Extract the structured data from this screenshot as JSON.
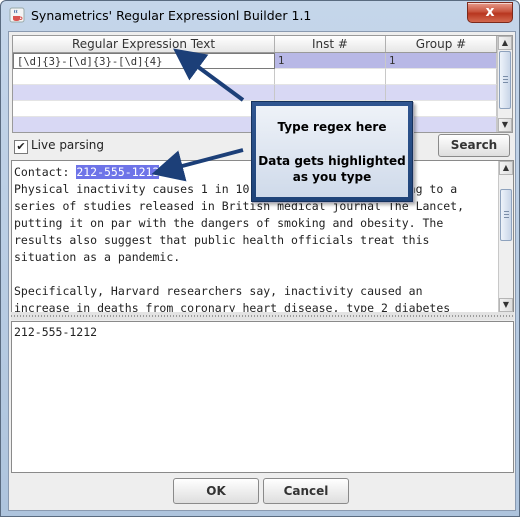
{
  "window": {
    "title": "Synametrics' Regular Expressionl Builder 1.1",
    "close_glyph": "x"
  },
  "table": {
    "columns": [
      "Regular Expression Text",
      "Inst #",
      "Group #"
    ],
    "rows": [
      [
        "[\\d]{3}-[\\d]{3}-[\\d]{4}",
        "1",
        "1"
      ],
      [
        "",
        "",
        ""
      ],
      [
        "",
        "",
        ""
      ],
      [
        "",
        "",
        ""
      ],
      [
        "",
        "",
        ""
      ]
    ]
  },
  "live_parsing": {
    "label": "Live parsing",
    "checked": true,
    "check_glyph": "✔"
  },
  "search_button": "Search",
  "text_area": {
    "contact_label": "Contact: ",
    "highlight": "212-555-1212",
    "lines": [
      "Physical inactivity causes 1 in 10",
      "series of studies released in British medical journal The Lancet,",
      "putting it on par with the dangers of smoking and obesity. The",
      "results also suggest that public health officials treat this",
      "situation as a pandemic.",
      "",
      "Specifically, Harvard researchers say, inactivity caused an",
      "increase in deaths from coronary heart disease, type 2 diabetes"
    ],
    "line1_tail": "rding to a"
  },
  "result_text": "212-555-1212",
  "buttons": {
    "ok": "OK",
    "cancel": "Cancel"
  },
  "callout": {
    "line1": "Type regex here",
    "line2": "Data gets highlighted as you type"
  },
  "scroll_arrows": {
    "up": "▲",
    "down": "▼"
  }
}
